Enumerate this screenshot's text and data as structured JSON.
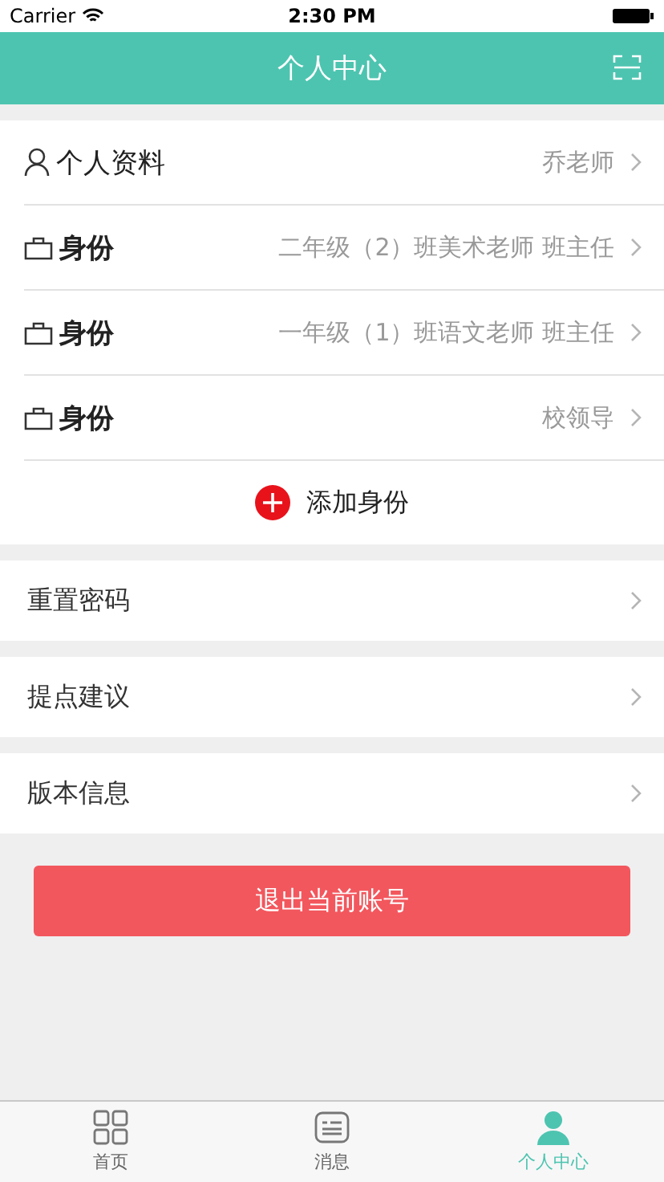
{
  "status_bar": {
    "carrier": "Carrier",
    "time": "2:30 PM"
  },
  "nav": {
    "title": "个人中心"
  },
  "profile_rows": [
    {
      "kind": "profile",
      "label": "个人资料",
      "value": "乔老师"
    },
    {
      "kind": "identity",
      "label": "身份",
      "value": "二年级（2）班美术老师 班主任"
    },
    {
      "kind": "identity",
      "label": "身份",
      "value": "一年级（1）班语文老师 班主任"
    },
    {
      "kind": "identity",
      "label": "身份",
      "value": "校领导"
    }
  ],
  "add_identity": "添加身份",
  "menu_rows": [
    {
      "label": "重置密码"
    },
    {
      "label": "提点建议"
    },
    {
      "label": "版本信息"
    }
  ],
  "logout_button": "退出当前账号",
  "tabs": [
    {
      "kind": "home",
      "label": "首页",
      "selected": false
    },
    {
      "kind": "message",
      "label": "消息",
      "selected": false
    },
    {
      "kind": "me",
      "label": "个人中心",
      "selected": true
    }
  ]
}
